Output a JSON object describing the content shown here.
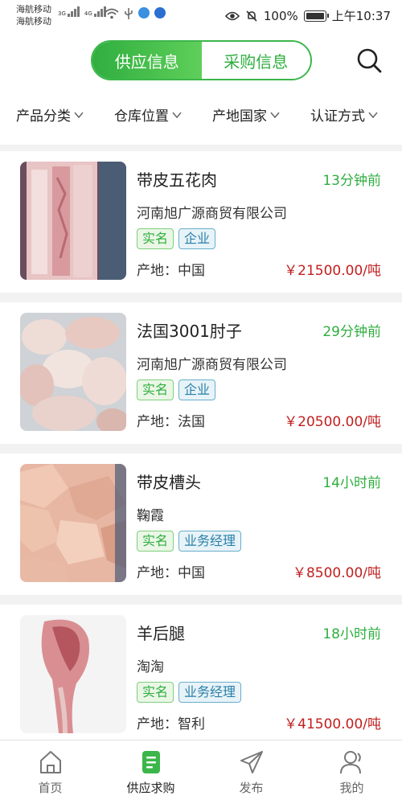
{
  "status_bar": {
    "carrier_1": "海航移动",
    "carrier_2": "海航移动",
    "net_1": "3G",
    "net_2": "4G",
    "battery": "100%",
    "time": "上午10:37"
  },
  "header": {
    "tabs": [
      {
        "label": "供应信息",
        "active": true
      },
      {
        "label": "采购信息",
        "active": false
      }
    ],
    "search_icon": "search-icon"
  },
  "filters": [
    {
      "label": "产品分类"
    },
    {
      "label": "仓库位置"
    },
    {
      "label": "产地国家"
    },
    {
      "label": "认证方式"
    }
  ],
  "listings": [
    {
      "title": "带皮五花肉",
      "time": "13分钟前",
      "company": "河南旭广源商贸有限公司",
      "tags": [
        "实名",
        "企业"
      ],
      "origin": "产地：中国",
      "price": "￥21500.00/吨"
    },
    {
      "title": "法国3001肘子",
      "time": "29分钟前",
      "company": "河南旭广源商贸有限公司",
      "tags": [
        "实名",
        "企业"
      ],
      "origin": "产地：法国",
      "price": "￥20500.00/吨"
    },
    {
      "title": "带皮槽头",
      "time": "14小时前",
      "company": "鞠霞",
      "tags": [
        "实名",
        "业务经理"
      ],
      "origin": "产地：中国",
      "price": "￥8500.00/吨"
    },
    {
      "title": "羊后腿",
      "time": "18小时前",
      "company": "淘淘",
      "tags": [
        "实名",
        "业务经理"
      ],
      "origin": "产地：智利",
      "price": "￥41500.00/吨"
    }
  ],
  "bottom_nav": [
    {
      "label": "首页",
      "icon": "home-icon",
      "active": false
    },
    {
      "label": "供应求购",
      "icon": "supply-icon",
      "active": true
    },
    {
      "label": "发布",
      "icon": "send-icon",
      "active": false
    },
    {
      "label": "我的",
      "icon": "profile-icon",
      "active": false
    }
  ],
  "colors": {
    "accent": "#2fae3f",
    "price": "#c0201f",
    "tag_blue": "#2a7fa8"
  }
}
